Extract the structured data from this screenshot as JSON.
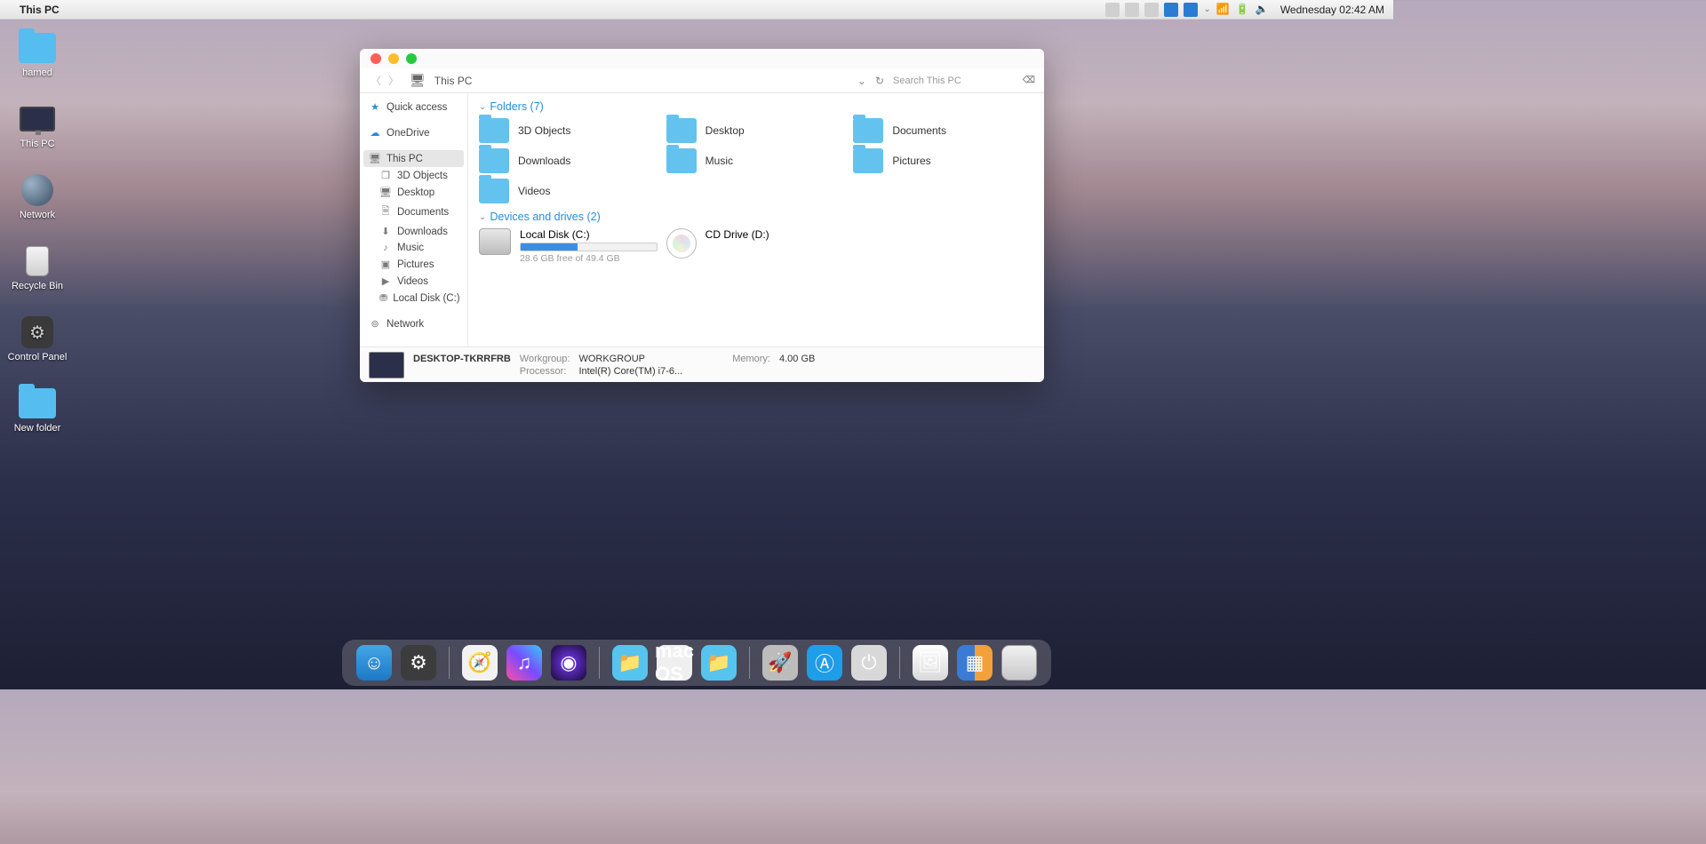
{
  "menubar": {
    "apple": "",
    "app_title": "This PC",
    "clock": "Wednesday 02:42 AM",
    "tray_icons": [
      "app1",
      "app2",
      "app3",
      "edge1",
      "edge2",
      "chevron",
      "wifi",
      "battery",
      "volume"
    ]
  },
  "desktop_icons": [
    {
      "name": "hamed",
      "type": "folder"
    },
    {
      "name": "This PC",
      "type": "monitor"
    },
    {
      "name": "Network",
      "type": "network"
    },
    {
      "name": "Recycle Bin",
      "type": "trash"
    },
    {
      "name": "Control Panel",
      "type": "gear"
    },
    {
      "name": "New folder",
      "type": "folder"
    }
  ],
  "window": {
    "breadcrumb": "This PC",
    "search_placeholder": "Search This PC",
    "sidebar": {
      "quick_access": "Quick access",
      "onedrive": "OneDrive",
      "this_pc": "This PC",
      "children": [
        "3D Objects",
        "Desktop",
        "Documents",
        "Downloads",
        "Music",
        "Pictures",
        "Videos",
        "Local Disk (C:)"
      ],
      "network": "Network"
    },
    "sections": {
      "folders": {
        "title": "Folders (7)",
        "items": [
          "3D Objects",
          "Desktop",
          "Documents",
          "Downloads",
          "Music",
          "Pictures",
          "Videos"
        ]
      },
      "drives": {
        "title": "Devices and drives (2)",
        "local": {
          "label": "Local Disk (C:)",
          "free_text": "28.6 GB free of 49.4 GB",
          "used_pct": 42
        },
        "cd": {
          "label": "CD Drive (D:)"
        }
      }
    },
    "status": {
      "computer_name": "DESKTOP-TKRRFRB",
      "workgroup_k": "Workgroup:",
      "workgroup_v": "WORKGROUP",
      "processor_k": "Processor:",
      "processor_v": "Intel(R) Core(TM) i7-6...",
      "memory_k": "Memory:",
      "memory_v": "4.00 GB"
    }
  },
  "dock": [
    "finder",
    "pref",
    "sep",
    "safari",
    "itunes",
    "siri",
    "sep",
    "blue",
    "macos",
    "blue",
    "sep",
    "launch",
    "store",
    "power",
    "sep",
    "pic",
    "grid",
    "trash"
  ]
}
